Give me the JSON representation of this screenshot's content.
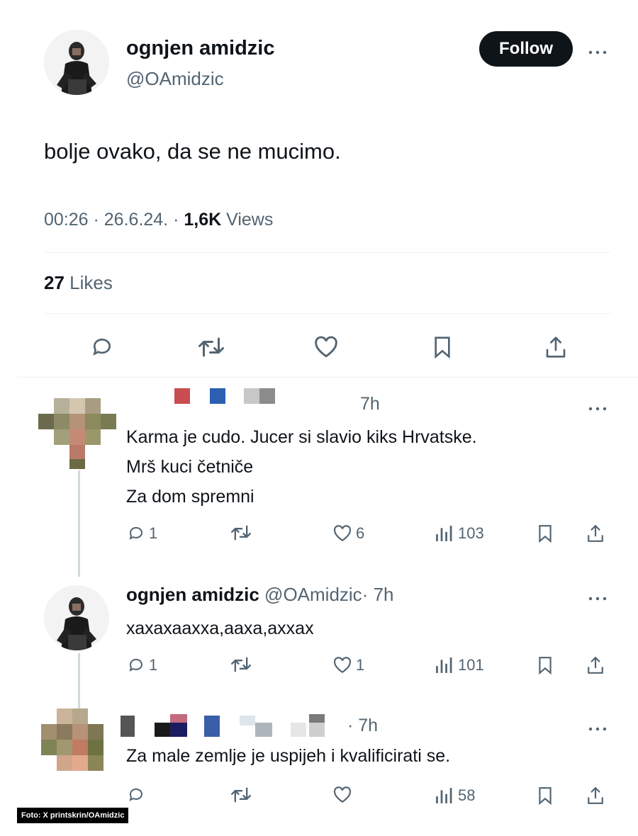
{
  "tweet": {
    "author_name": "ognjen amidzic",
    "author_handle": "@OAmidzic",
    "follow_label": "Follow",
    "text": "bolje ovako, da se ne mucimo.",
    "time": "00:26",
    "date": "26.6.24.",
    "views_count": "1,6K",
    "views_label": "Views",
    "likes_count": "27",
    "likes_label": "Likes"
  },
  "replies": [
    {
      "time": "7h",
      "lines": [
        "Karma je cudo. Jucer si slavio kiks Hrvatske.",
        "Mrš kuci četniče",
        "Za dom spremni"
      ],
      "reply_count": "1",
      "retweet_count": "",
      "like_count": "6",
      "view_count": "103"
    },
    {
      "author_name": "ognjen amidzic",
      "author_handle": "@OAmidzic",
      "time": "· 7h",
      "lines": [
        "хахахааххa,aaxa,axxax"
      ],
      "reply_count": "1",
      "retweet_count": "",
      "like_count": "1",
      "view_count": "101"
    },
    {
      "time": "· 7h",
      "lines": [
        "Za male zemlje je uspijeh i kvalificirati se."
      ],
      "reply_count": "",
      "retweet_count": "",
      "like_count": "",
      "view_count": "58"
    }
  ],
  "credit": "Foto: X printskrin/OAmidzic",
  "icons": [
    "reply-icon",
    "retweet-icon",
    "like-icon",
    "bookmark-icon",
    "share-icon",
    "views-icon",
    "more-icon"
  ],
  "colors": {
    "text": "#0f1419",
    "muted": "#536471",
    "divider": "#eff3f4",
    "follow_bg": "#0f1419"
  }
}
